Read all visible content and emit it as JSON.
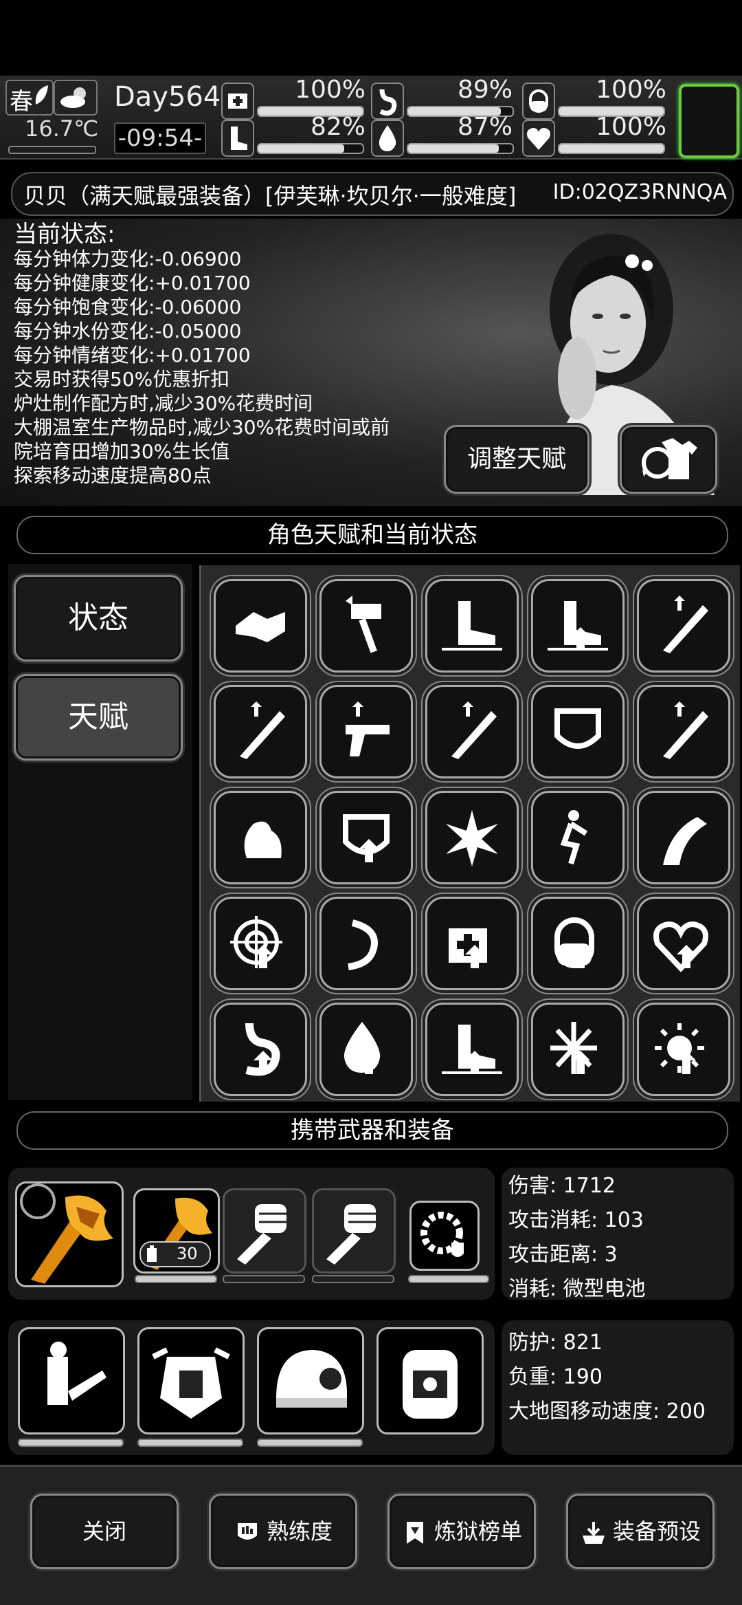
{
  "hud": {
    "season": "春",
    "temperature": "16.7℃",
    "day": "Day564",
    "clock": "-09:54-",
    "stats": [
      {
        "name": "medkit-icon",
        "value": "100%",
        "level": 1.0
      },
      {
        "name": "stomach-icon",
        "value": "89%",
        "level": 0.89
      },
      {
        "name": "pill-icon",
        "value": "100%",
        "level": 1.0
      },
      {
        "name": "boot-icon",
        "value": "82%",
        "level": 0.82
      },
      {
        "name": "water-drop-icon",
        "value": "87%",
        "level": 0.87
      },
      {
        "name": "heart-icon",
        "value": "100%",
        "level": 1.0
      }
    ]
  },
  "character": {
    "name": "贝贝（满天赋最强装备）[伊芙琳·坎贝尔·一般难度]",
    "id": "ID:02QZ3RNNQA"
  },
  "status": {
    "heading": "当前状态:",
    "lines": [
      "每分钟体力变化:-0.06900",
      "每分钟健康变化:+0.01700",
      "每分钟饱食变化:-0.06000",
      "每分钟水份变化:-0.05000",
      "每分钟情绪变化:+0.01700",
      "交易时获得50%优惠折扣",
      "炉灶制作配方时,减少30%花费时间",
      "大棚温室生产物品时,减少30%花费时间或前",
      "院培育田增加30%生长值",
      "探索移动速度提高80点"
    ]
  },
  "buttons": {
    "adjust_talent": "调整天赋"
  },
  "sections": {
    "talent_header": "角色天赋和当前状态",
    "equip_header": "携带武器和装备"
  },
  "tabs": {
    "status": "状态",
    "talent": "天赋"
  },
  "talent_icons": [
    "handshake-icon",
    "hammer-upgrade-icon",
    "speed-boot-icon",
    "sprint-boot-icon",
    "machete-upgrade-icon",
    "bat-upgrade-icon",
    "pistol-upgrade-icon",
    "crossbow-upgrade-icon",
    "armor-upgrade-icon",
    "syringe-upgrade-icon",
    "muscle-icon",
    "shield-upgrade-icon",
    "explosion-icon",
    "running-icon",
    "road-icon",
    "target-upgrade-icon",
    "claw-icon",
    "medkit-upgrade-icon",
    "pill-upgrade-icon",
    "heart-upgrade-icon",
    "stomach-upgrade-icon",
    "water-upgrade-icon",
    "boot-upgrade-icon",
    "cold-upgrade-icon",
    "heat-upgrade-icon"
  ],
  "weapon": {
    "ammo_count": "30",
    "stats": [
      "伤害: 1712",
      "攻击消耗: 103",
      "攻击距离: 3",
      "消耗: 微型电池"
    ]
  },
  "armor": {
    "stats": [
      "防护: 821",
      "负重: 190",
      "大地图移动速度: 200"
    ]
  },
  "bottom_buttons": [
    "关闭",
    "熟练度",
    "炼狱榜单",
    "装备预设"
  ],
  "colors": {
    "accent_green": "#6ecb3f",
    "weapon_orange": "#f0a020"
  }
}
